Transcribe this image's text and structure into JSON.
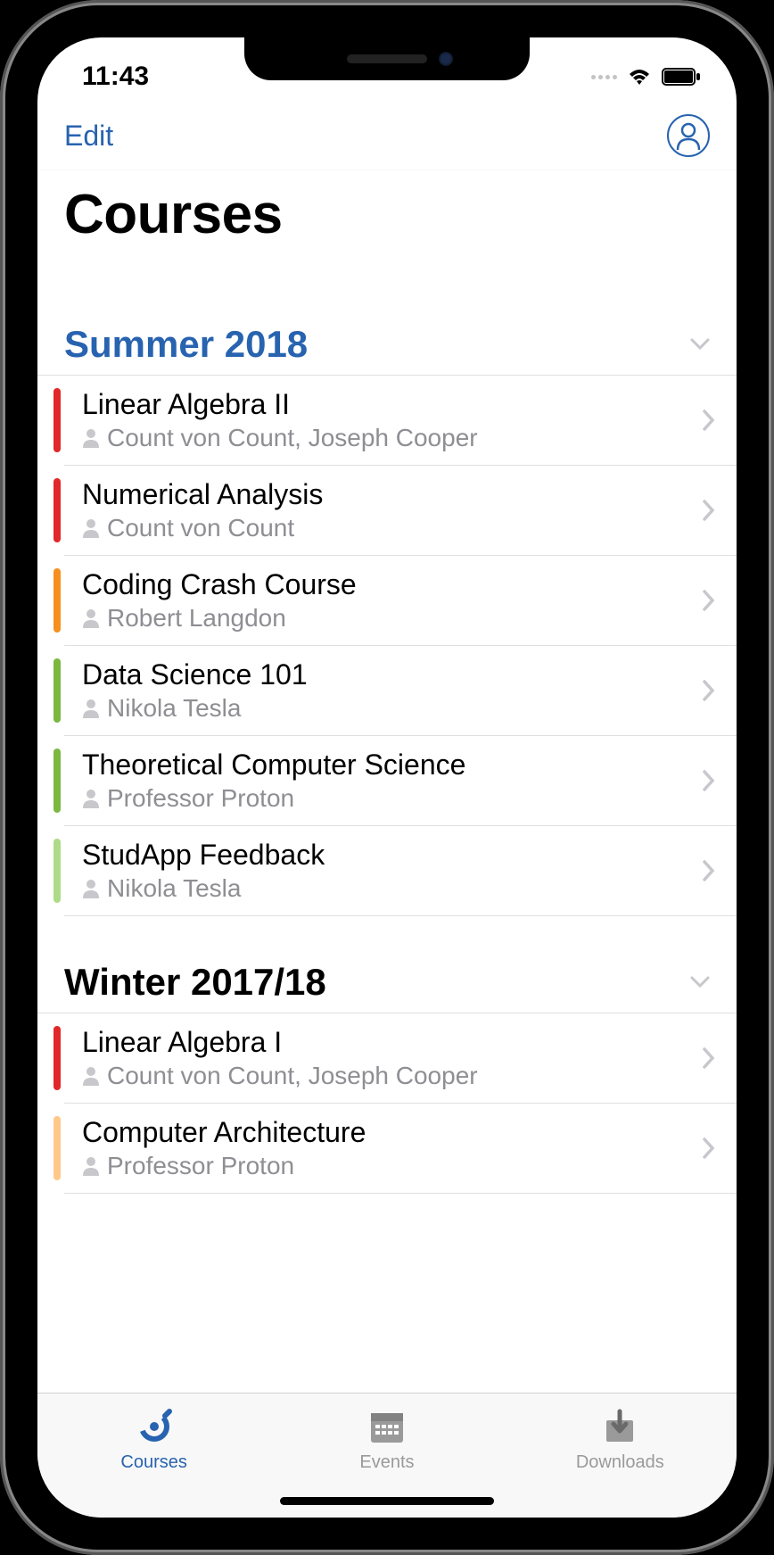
{
  "status": {
    "time": "11:43"
  },
  "nav": {
    "edit": "Edit"
  },
  "header": {
    "title": "Courses"
  },
  "sections": [
    {
      "title": "Summer 2018",
      "active": true,
      "courses": [
        {
          "title": "Linear Algebra II",
          "instructors": "Count von Count, Joseph Cooper",
          "color": "#e12727"
        },
        {
          "title": "Numerical Analysis",
          "instructors": "Count von Count",
          "color": "#e12727"
        },
        {
          "title": "Coding Crash Course",
          "instructors": "Robert Langdon",
          "color": "#f5901e"
        },
        {
          "title": "Data Science 101",
          "instructors": "Nikola Tesla",
          "color": "#7ab840"
        },
        {
          "title": "Theoretical Computer Science",
          "instructors": "Professor Proton",
          "color": "#7ab840"
        },
        {
          "title": "StudApp Feedback",
          "instructors": "Nikola Tesla",
          "color": "#aedb87"
        }
      ]
    },
    {
      "title": "Winter 2017/18",
      "active": false,
      "courses": [
        {
          "title": "Linear Algebra I",
          "instructors": "Count von Count, Joseph Cooper",
          "color": "#e12727"
        },
        {
          "title": "Computer Architecture",
          "instructors": "Professor Proton",
          "color": "#ffc88a"
        }
      ]
    }
  ],
  "tabs": {
    "courses": "Courses",
    "events": "Events",
    "downloads": "Downloads"
  }
}
